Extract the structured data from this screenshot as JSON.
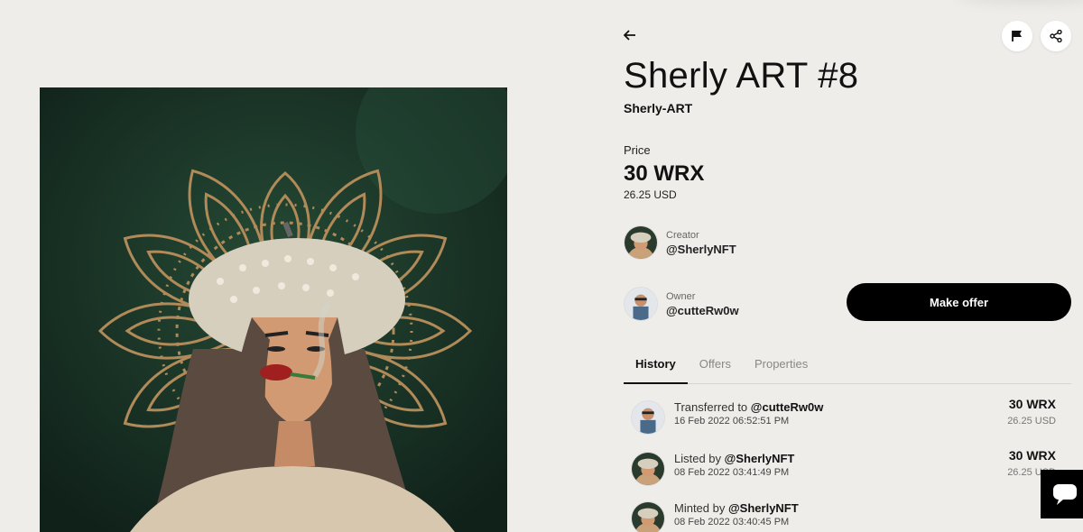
{
  "nft": {
    "title": "Sherly ART #8",
    "collection": "Sherly-ART",
    "price_label": "Price",
    "price": "30 WRX",
    "price_usd": "26.25 USD"
  },
  "creator": {
    "role": "Creator",
    "handle": "@SherlyNFT"
  },
  "owner": {
    "role": "Owner",
    "handle": "@cutteRw0w"
  },
  "actions": {
    "make_offer": "Make offer",
    "back_icon": "arrow-left-icon",
    "flag_icon": "flag-icon",
    "share_icon": "share-icon",
    "chat_icon": "chat-icon"
  },
  "tabs": [
    {
      "label": "History",
      "active": true
    },
    {
      "label": "Offers",
      "active": false
    },
    {
      "label": "Properties",
      "active": false
    }
  ],
  "history": [
    {
      "action": "Transferred to",
      "user": "@cutteRw0w",
      "date": "16 Feb 2022 06:52:51 PM",
      "amount": "30 WRX",
      "usd": "26.25 USD"
    },
    {
      "action": "Listed by",
      "user": "@SherlyNFT",
      "date": "08 Feb 2022 03:41:49 PM",
      "amount": "30 WRX",
      "usd": "26.25 USD"
    },
    {
      "action": "Minted by",
      "user": "@SherlyNFT",
      "date": "08 Feb 2022 03:40:45 PM",
      "amount": "",
      "usd": ""
    }
  ],
  "colors": {
    "background": "#efedea",
    "artwork_bg": "#15291d",
    "mandala": "#b08a58",
    "button": "#000000"
  }
}
